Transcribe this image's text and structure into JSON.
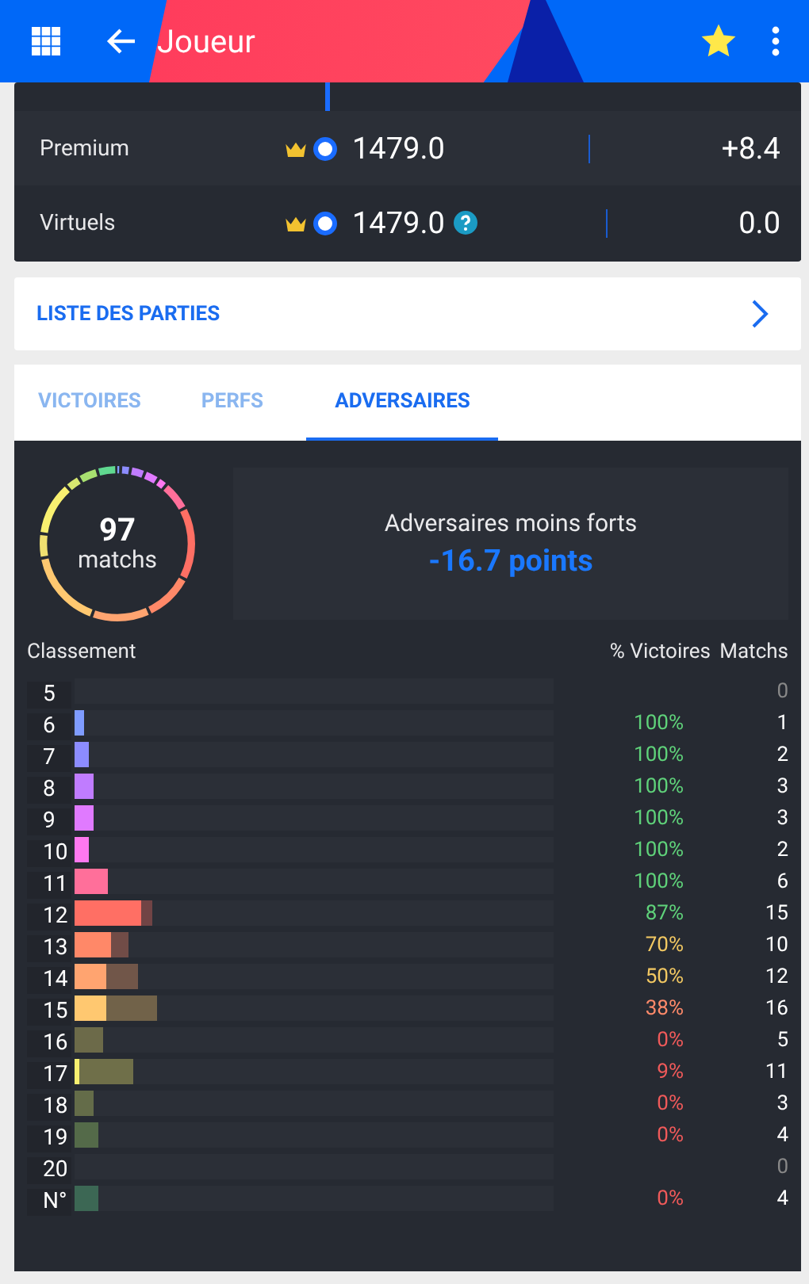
{
  "app_bar": {
    "title": "Joueur",
    "favorite": true
  },
  "ratings": [
    {
      "label": "Premium",
      "value": "1479.0",
      "delta": "+8.4",
      "help": false
    },
    {
      "label": "Virtuels",
      "value": "1479.0",
      "delta": "0.0",
      "help": true
    }
  ],
  "games_link": {
    "label": "LISTE DES PARTIES"
  },
  "tabs": [
    {
      "label": "VICTOIRES",
      "selected": false
    },
    {
      "label": "PERFS",
      "selected": false
    },
    {
      "label": "ADVERSAIRES",
      "selected": true
    }
  ],
  "summary": {
    "count": "97",
    "unit": "matchs",
    "title": "Adversaires moins forts",
    "points": "-16.7 points"
  },
  "table": {
    "columns": [
      "Classement",
      "% Victoires",
      "Matchs"
    ],
    "rows": [
      {
        "rank": "5",
        "percent": "",
        "matches": "0"
      },
      {
        "rank": "6",
        "percent": "100%",
        "matches": "1"
      },
      {
        "rank": "7",
        "percent": "100%",
        "matches": "2"
      },
      {
        "rank": "8",
        "percent": "100%",
        "matches": "3"
      },
      {
        "rank": "9",
        "percent": "100%",
        "matches": "3"
      },
      {
        "rank": "10",
        "percent": "100%",
        "matches": "2"
      },
      {
        "rank": "11",
        "percent": "100%",
        "matches": "6"
      },
      {
        "rank": "12",
        "percent": "87%",
        "matches": "15"
      },
      {
        "rank": "13",
        "percent": "70%",
        "matches": "10"
      },
      {
        "rank": "14",
        "percent": "50%",
        "matches": "12"
      },
      {
        "rank": "15",
        "percent": "38%",
        "matches": "16"
      },
      {
        "rank": "16",
        "percent": "0%",
        "matches": "5"
      },
      {
        "rank": "17",
        "percent": "9%",
        "matches": "11"
      },
      {
        "rank": "18",
        "percent": "0%",
        "matches": "3"
      },
      {
        "rank": "19",
        "percent": "0%",
        "matches": "4"
      },
      {
        "rank": "20",
        "percent": "",
        "matches": "0"
      },
      {
        "rank": "N°",
        "percent": "0%",
        "matches": "4"
      }
    ]
  }
}
